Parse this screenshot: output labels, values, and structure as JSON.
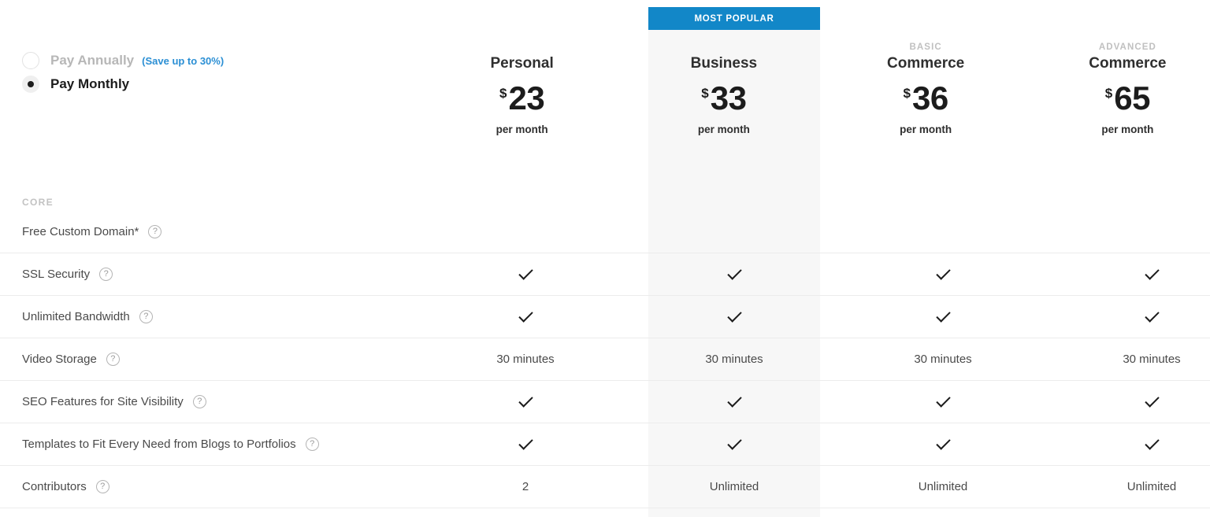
{
  "billing": {
    "annual": {
      "label": "Pay Annually",
      "note": "(Save up to 30%)",
      "selected": false
    },
    "monthly": {
      "label": "Pay Monthly",
      "selected": true
    }
  },
  "popular_badge": "MOST POPULAR",
  "currency_symbol": "$",
  "period_label": "per month",
  "plans": [
    {
      "eyebrow": "",
      "name": "Personal",
      "price": "23",
      "period": "per month",
      "highlighted": false
    },
    {
      "eyebrow": "",
      "name": "Business",
      "price": "33",
      "period": "per month",
      "highlighted": true
    },
    {
      "eyebrow": "BASIC",
      "name": "Commerce",
      "price": "36",
      "period": "per month",
      "highlighted": false
    },
    {
      "eyebrow": "ADVANCED",
      "name": "Commerce",
      "price": "65",
      "period": "per month",
      "highlighted": false
    }
  ],
  "section_label": "CORE",
  "help_glyph": "?",
  "features": [
    {
      "name": "Free Custom Domain*",
      "values": [
        "",
        "",
        "",
        ""
      ]
    },
    {
      "name": "SSL Security",
      "values": [
        "check",
        "check",
        "check",
        "check"
      ]
    },
    {
      "name": "Unlimited Bandwidth",
      "values": [
        "check",
        "check",
        "check",
        "check"
      ]
    },
    {
      "name": "Video Storage",
      "values": [
        "30 minutes",
        "30 minutes",
        "30 minutes",
        "30 minutes"
      ]
    },
    {
      "name": "SEO Features for Site Visibility",
      "values": [
        "check",
        "check",
        "check",
        "check"
      ]
    },
    {
      "name": "Templates to Fit Every Need from Blogs to Portfolios",
      "values": [
        "check",
        "check",
        "check",
        "check"
      ]
    },
    {
      "name": "Contributors",
      "values": [
        "2",
        "Unlimited",
        "Unlimited",
        "Unlimited"
      ]
    }
  ],
  "colors": {
    "accent_blue": "#1287c8",
    "link_blue": "#2b8fd4",
    "highlight_bg": "#f7f7f7",
    "text_dark": "#1c1c1c",
    "text_muted": "#4a4a4a",
    "text_light": "#c0c0c0",
    "row_border": "#ececec"
  }
}
